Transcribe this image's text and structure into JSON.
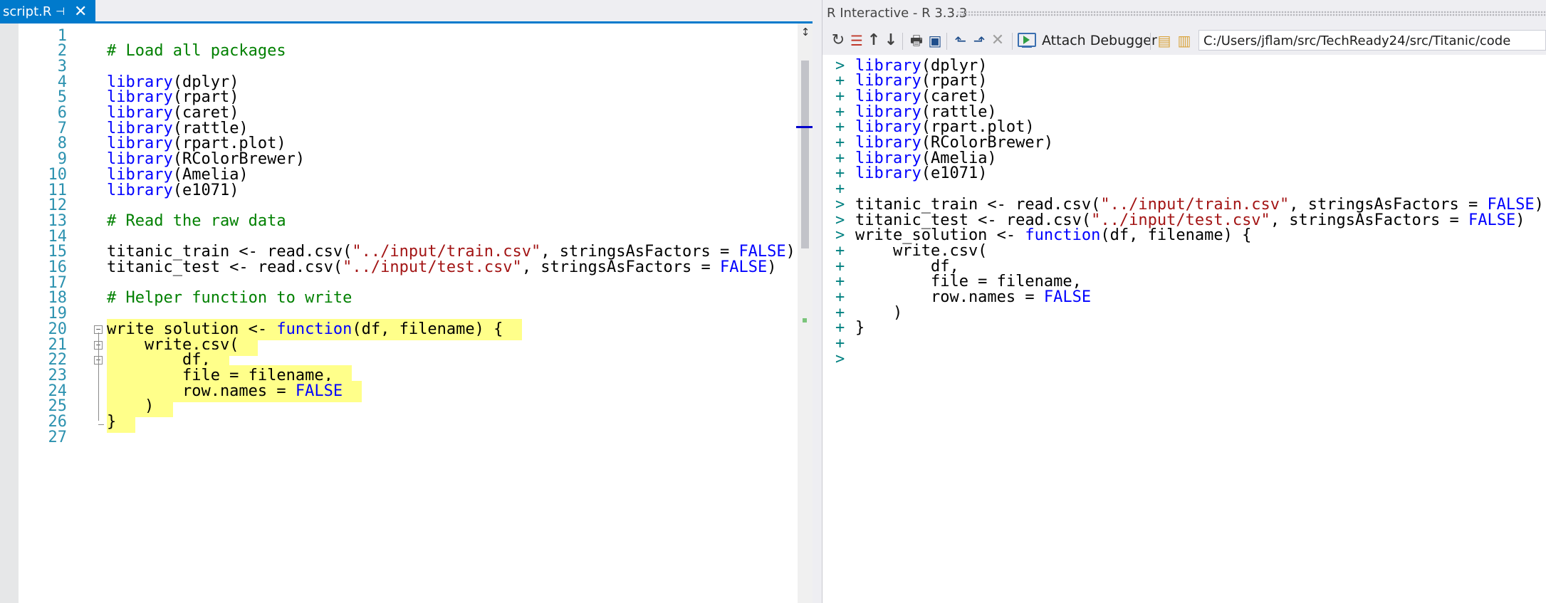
{
  "editor": {
    "tab": {
      "title": "script.R",
      "pin_icon": "pin-icon",
      "close_icon": "close-icon"
    },
    "split_icon": "split-icon",
    "lines": [
      {
        "n": "1",
        "tokens": []
      },
      {
        "n": "2",
        "tokens": [
          {
            "c": "cm",
            "t": "# Load all packages"
          }
        ]
      },
      {
        "n": "3",
        "tokens": []
      },
      {
        "n": "4",
        "tokens": [
          {
            "c": "kw",
            "t": "library"
          },
          {
            "c": "tx",
            "t": "(dplyr)"
          }
        ]
      },
      {
        "n": "5",
        "tokens": [
          {
            "c": "kw",
            "t": "library"
          },
          {
            "c": "tx",
            "t": "(rpart)"
          }
        ]
      },
      {
        "n": "6",
        "tokens": [
          {
            "c": "kw",
            "t": "library"
          },
          {
            "c": "tx",
            "t": "(caret)"
          }
        ]
      },
      {
        "n": "7",
        "tokens": [
          {
            "c": "kw",
            "t": "library"
          },
          {
            "c": "tx",
            "t": "(rattle)"
          }
        ]
      },
      {
        "n": "8",
        "tokens": [
          {
            "c": "kw",
            "t": "library"
          },
          {
            "c": "tx",
            "t": "(rpart.plot)"
          }
        ]
      },
      {
        "n": "9",
        "tokens": [
          {
            "c": "kw",
            "t": "library"
          },
          {
            "c": "tx",
            "t": "(RColorBrewer)"
          }
        ]
      },
      {
        "n": "10",
        "tokens": [
          {
            "c": "kw",
            "t": "library"
          },
          {
            "c": "tx",
            "t": "(Amelia)"
          }
        ]
      },
      {
        "n": "11",
        "tokens": [
          {
            "c": "kw",
            "t": "library"
          },
          {
            "c": "tx",
            "t": "(e1071)"
          }
        ]
      },
      {
        "n": "12",
        "tokens": []
      },
      {
        "n": "13",
        "tokens": [
          {
            "c": "cm",
            "t": "# Read the raw data"
          }
        ]
      },
      {
        "n": "14",
        "tokens": []
      },
      {
        "n": "15",
        "tokens": [
          {
            "c": "tx",
            "t": "titanic_train <- read.csv("
          },
          {
            "c": "st",
            "t": "\"../input/train.csv\""
          },
          {
            "c": "tx",
            "t": ", stringsAsFactors = "
          },
          {
            "c": "kw",
            "t": "FALSE"
          },
          {
            "c": "tx",
            "t": ")"
          }
        ]
      },
      {
        "n": "16",
        "tokens": [
          {
            "c": "tx",
            "t": "titanic_test <- read.csv("
          },
          {
            "c": "st",
            "t": "\"../input/test.csv\""
          },
          {
            "c": "tx",
            "t": ", stringsAsFactors = "
          },
          {
            "c": "kw",
            "t": "FALSE"
          },
          {
            "c": "tx",
            "t": ")"
          }
        ]
      },
      {
        "n": "17",
        "tokens": []
      },
      {
        "n": "18",
        "tokens": [
          {
            "c": "cm",
            "t": "# Helper function to write"
          }
        ]
      },
      {
        "n": "19",
        "tokens": []
      },
      {
        "n": "20",
        "hl": true,
        "fold": "minus",
        "tokens": [
          {
            "c": "tx",
            "t": "write_solution <- "
          },
          {
            "c": "kw",
            "t": "function"
          },
          {
            "c": "tx",
            "t": "(df, filename) {  "
          }
        ]
      },
      {
        "n": "21",
        "hl": true,
        "fold": "minus",
        "tokens": [
          {
            "c": "tx",
            "t": "    write.csv(  "
          }
        ]
      },
      {
        "n": "22",
        "hl": true,
        "fold": "minus",
        "tokens": [
          {
            "c": "tx",
            "t": "        df,  "
          }
        ]
      },
      {
        "n": "23",
        "hl": true,
        "tokens": [
          {
            "c": "tx",
            "t": "        file = filename,  "
          }
        ]
      },
      {
        "n": "24",
        "hl": true,
        "tokens": [
          {
            "c": "tx",
            "t": "        row.names = "
          },
          {
            "c": "kw",
            "t": "FALSE"
          },
          {
            "c": "tx",
            "t": "  "
          }
        ]
      },
      {
        "n": "25",
        "hl": true,
        "tokens": [
          {
            "c": "tx",
            "t": "    )  "
          }
        ]
      },
      {
        "n": "26",
        "hl": true,
        "tokens": [
          {
            "c": "tx",
            "t": "}  "
          }
        ]
      },
      {
        "n": "27",
        "tokens": []
      }
    ]
  },
  "repl": {
    "title": "R Interactive - R 3.3.3",
    "toolbar": {
      "icons": [
        "reset-icon",
        "clear-icon",
        "history-up-icon",
        "history-down-icon",
        "load-workspace-icon",
        "save-workspace-icon",
        "source-script-icon",
        "source-script-echo-icon",
        "interrupt-icon"
      ],
      "attach_label": "Attach Debugger",
      "dir_icons": [
        "select-directory-icon",
        "set-to-project-directory-icon"
      ],
      "working_dir": "C:/Users/jflam/src/TechReady24/src/Titanic/code"
    },
    "lines": [
      {
        "p": ">",
        "tokens": [
          {
            "c": "kw",
            "t": "library"
          },
          {
            "c": "tx",
            "t": "(dplyr)"
          }
        ]
      },
      {
        "p": "+",
        "tokens": [
          {
            "c": "kw",
            "t": "library"
          },
          {
            "c": "tx",
            "t": "(rpart)"
          }
        ]
      },
      {
        "p": "+",
        "tokens": [
          {
            "c": "kw",
            "t": "library"
          },
          {
            "c": "tx",
            "t": "(caret)"
          }
        ]
      },
      {
        "p": "+",
        "tokens": [
          {
            "c": "kw",
            "t": "library"
          },
          {
            "c": "tx",
            "t": "(rattle)"
          }
        ]
      },
      {
        "p": "+",
        "tokens": [
          {
            "c": "kw",
            "t": "library"
          },
          {
            "c": "tx",
            "t": "(rpart.plot)"
          }
        ]
      },
      {
        "p": "+",
        "tokens": [
          {
            "c": "kw",
            "t": "library"
          },
          {
            "c": "tx",
            "t": "(RColorBrewer)"
          }
        ]
      },
      {
        "p": "+",
        "tokens": [
          {
            "c": "kw",
            "t": "library"
          },
          {
            "c": "tx",
            "t": "(Amelia)"
          }
        ]
      },
      {
        "p": "+",
        "tokens": [
          {
            "c": "kw",
            "t": "library"
          },
          {
            "c": "tx",
            "t": "(e1071)"
          }
        ]
      },
      {
        "p": "+",
        "tokens": []
      },
      {
        "p": ">",
        "tokens": [
          {
            "c": "tx",
            "t": "titanic_train <- read.csv("
          },
          {
            "c": "st",
            "t": "\"../input/train.csv\""
          },
          {
            "c": "tx",
            "t": ", stringsAsFactors = "
          },
          {
            "c": "kw",
            "t": "FALSE"
          },
          {
            "c": "tx",
            "t": ")"
          }
        ]
      },
      {
        "p": ">",
        "tokens": [
          {
            "c": "tx",
            "t": "titanic_test <- read.csv("
          },
          {
            "c": "st",
            "t": "\"../input/test.csv\""
          },
          {
            "c": "tx",
            "t": ", stringsAsFactors = "
          },
          {
            "c": "kw",
            "t": "FALSE"
          },
          {
            "c": "tx",
            "t": ")"
          }
        ]
      },
      {
        "p": ">",
        "tokens": [
          {
            "c": "tx",
            "t": "write_solution <- "
          },
          {
            "c": "kw",
            "t": "function"
          },
          {
            "c": "tx",
            "t": "(df, filename) {"
          }
        ]
      },
      {
        "p": "+",
        "tokens": [
          {
            "c": "tx",
            "t": "    write.csv("
          }
        ]
      },
      {
        "p": "+",
        "tokens": [
          {
            "c": "tx",
            "t": "        df,"
          }
        ]
      },
      {
        "p": "+",
        "tokens": [
          {
            "c": "tx",
            "t": "        file = filename,"
          }
        ]
      },
      {
        "p": "+",
        "tokens": [
          {
            "c": "tx",
            "t": "        row.names = "
          },
          {
            "c": "kw",
            "t": "FALSE"
          }
        ]
      },
      {
        "p": "+",
        "tokens": [
          {
            "c": "tx",
            "t": "    )"
          }
        ]
      },
      {
        "p": "+",
        "tokens": [
          {
            "c": "tx",
            "t": "}"
          }
        ]
      },
      {
        "p": "+",
        "tokens": []
      },
      {
        "p": ">",
        "tokens": []
      }
    ]
  },
  "colors": {
    "keyword": "#0000ff",
    "comment": "#008000",
    "string": "#a31515",
    "line_number": "#2b91af",
    "prompt": "#008080",
    "highlight": "#ffff8a",
    "accent": "#007acc"
  }
}
